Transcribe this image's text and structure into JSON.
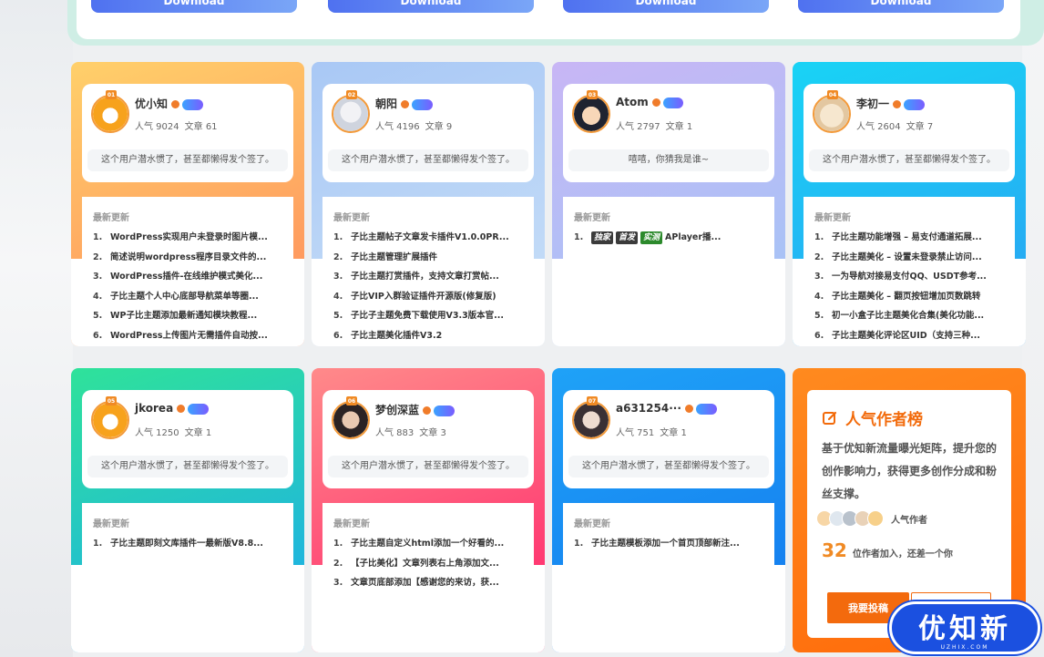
{
  "downloads": [
    "Download",
    "Download",
    "Download",
    "Download"
  ],
  "authors": [
    {
      "rank": "01",
      "name": "优小知",
      "popularity": "人气 9024",
      "articles": "文章 61",
      "signature": "这个用户潜水惯了，甚至都懒得发个签了。",
      "updates_title": "最新更新",
      "updates": [
        {
          "n": "1.",
          "text": "WordPress实现用户未登录时图片模..."
        },
        {
          "n": "2.",
          "text": "简述说明wordpress程序目录文件的..."
        },
        {
          "n": "3.",
          "text": "WordPress插件-在线维护模式美化..."
        },
        {
          "n": "4.",
          "text": "子比主题个人中心底部导航菜单等圈..."
        },
        {
          "n": "5.",
          "text": "WP子比主题添加最新通知模块教程..."
        },
        {
          "n": "6.",
          "text": "WordPress上传图片无需插件自动按..."
        }
      ],
      "colors": {
        "top": "#ffd06a",
        "bottom": "#ff8a5c"
      }
    },
    {
      "rank": "02",
      "name": "朝阳",
      "popularity": "人气 4196",
      "articles": "文章 9",
      "signature": "这个用户潜水惯了，甚至都懒得发个签了。",
      "updates_title": "最新更新",
      "updates": [
        {
          "n": "1.",
          "text": "子比主题帖子文章发卡插件V1.0.0PR..."
        },
        {
          "n": "2.",
          "text": "子比主题管理扩展插件"
        },
        {
          "n": "3.",
          "text": "子比主题打赏插件，支持文章打赏帖..."
        },
        {
          "n": "4.",
          "text": "子比VIP入群验证插件开源版(修复版)"
        },
        {
          "n": "5.",
          "text": "子比子主题免费下载使用V3.3版本官..."
        },
        {
          "n": "6.",
          "text": "子比主题美化插件V3.2"
        }
      ],
      "colors": {
        "top": "#a9c8f5",
        "bottom": "#c9e0f8"
      }
    },
    {
      "rank": "03",
      "name": "Atom",
      "popularity": "人气 2797",
      "articles": "文章 1",
      "signature": "嘻嘻，你猜我是谁~",
      "updates_title": "最新更新",
      "updates": [
        {
          "n": "1.",
          "tags": [
            "独家",
            "首发",
            "实测"
          ],
          "text": "APlayer播..."
        }
      ],
      "colors": {
        "top": "#c8b6f5",
        "bottom": "#9fc6f6"
      }
    },
    {
      "rank": "04",
      "name": "李初一",
      "popularity": "人气 2604",
      "articles": "文章 7",
      "signature": "这个用户潜水惯了，甚至都懒得发个签了。",
      "updates_title": "最新更新",
      "updates": [
        {
          "n": "1.",
          "text": "子比主题功能增强 – 易支付通道拓展..."
        },
        {
          "n": "2.",
          "text": "子比主题美化 – 设置未登录禁止访问..."
        },
        {
          "n": "3.",
          "text": "一为导航对接易支付QQ、USDT参考..."
        },
        {
          "n": "4.",
          "text": "子比主题美化 – 翻页按钮增加页数跳转"
        },
        {
          "n": "5.",
          "text": "初一小盒子比主题美化合集(美化功能..."
        },
        {
          "n": "6.",
          "text": "子比主题美化评论区UID（支持三种..."
        }
      ],
      "colors": {
        "top": "#19d3f5",
        "bottom": "#2aa0f2"
      }
    },
    {
      "rank": "05",
      "name": "jkorea",
      "popularity": "人气 1250",
      "articles": "文章 1",
      "signature": "这个用户潜水惯了，甚至都懒得发个签了。",
      "updates_title": "最新更新",
      "updates": [
        {
          "n": "1.",
          "text": "子比主题即刻文库插件一最新版V8.8..."
        }
      ],
      "colors": {
        "top": "#2fe29a",
        "bottom": "#1aa8f2"
      }
    },
    {
      "rank": "06",
      "name": "梦创深蓝",
      "popularity": "人气 883",
      "articles": "文章 3",
      "signature": "这个用户潜水惯了，甚至都懒得发个签了。",
      "updates_title": "最新更新",
      "updates": [
        {
          "n": "1.",
          "text": "子比主题自定义html添加一个好看的..."
        },
        {
          "n": "2.",
          "text": "【子比美化】文章列表右上角添加文..."
        },
        {
          "n": "3.",
          "text": "文章页底部添加【感谢您的来访，获..."
        }
      ],
      "colors": {
        "top": "#ff8a8a",
        "bottom": "#ff1f6a"
      }
    },
    {
      "rank": "07",
      "name": "a631254···",
      "popularity": "人气 751",
      "articles": "文章 1",
      "signature": "这个用户潜水惯了，甚至都懒得发个签了。",
      "updates_title": "最新更新",
      "updates": [
        {
          "n": "1.",
          "text": "子比主题模板添加一个首页顶部新注..."
        }
      ],
      "colors": {
        "top": "#1fa2f7",
        "bottom": "#1277ee"
      }
    }
  ],
  "promo": {
    "title": "人气作者榜",
    "description": "基于优知新流量曝光矩阵，提升您的创作影响力，获得更多创作分成和粉丝支撑。",
    "avatars_label": "人气作者",
    "count": "32",
    "count_text": "位作者加入，还差一个你",
    "submit_label": "我要投稿"
  },
  "logo": {
    "text": "优知新",
    "sub": "UZHIX.COM"
  }
}
